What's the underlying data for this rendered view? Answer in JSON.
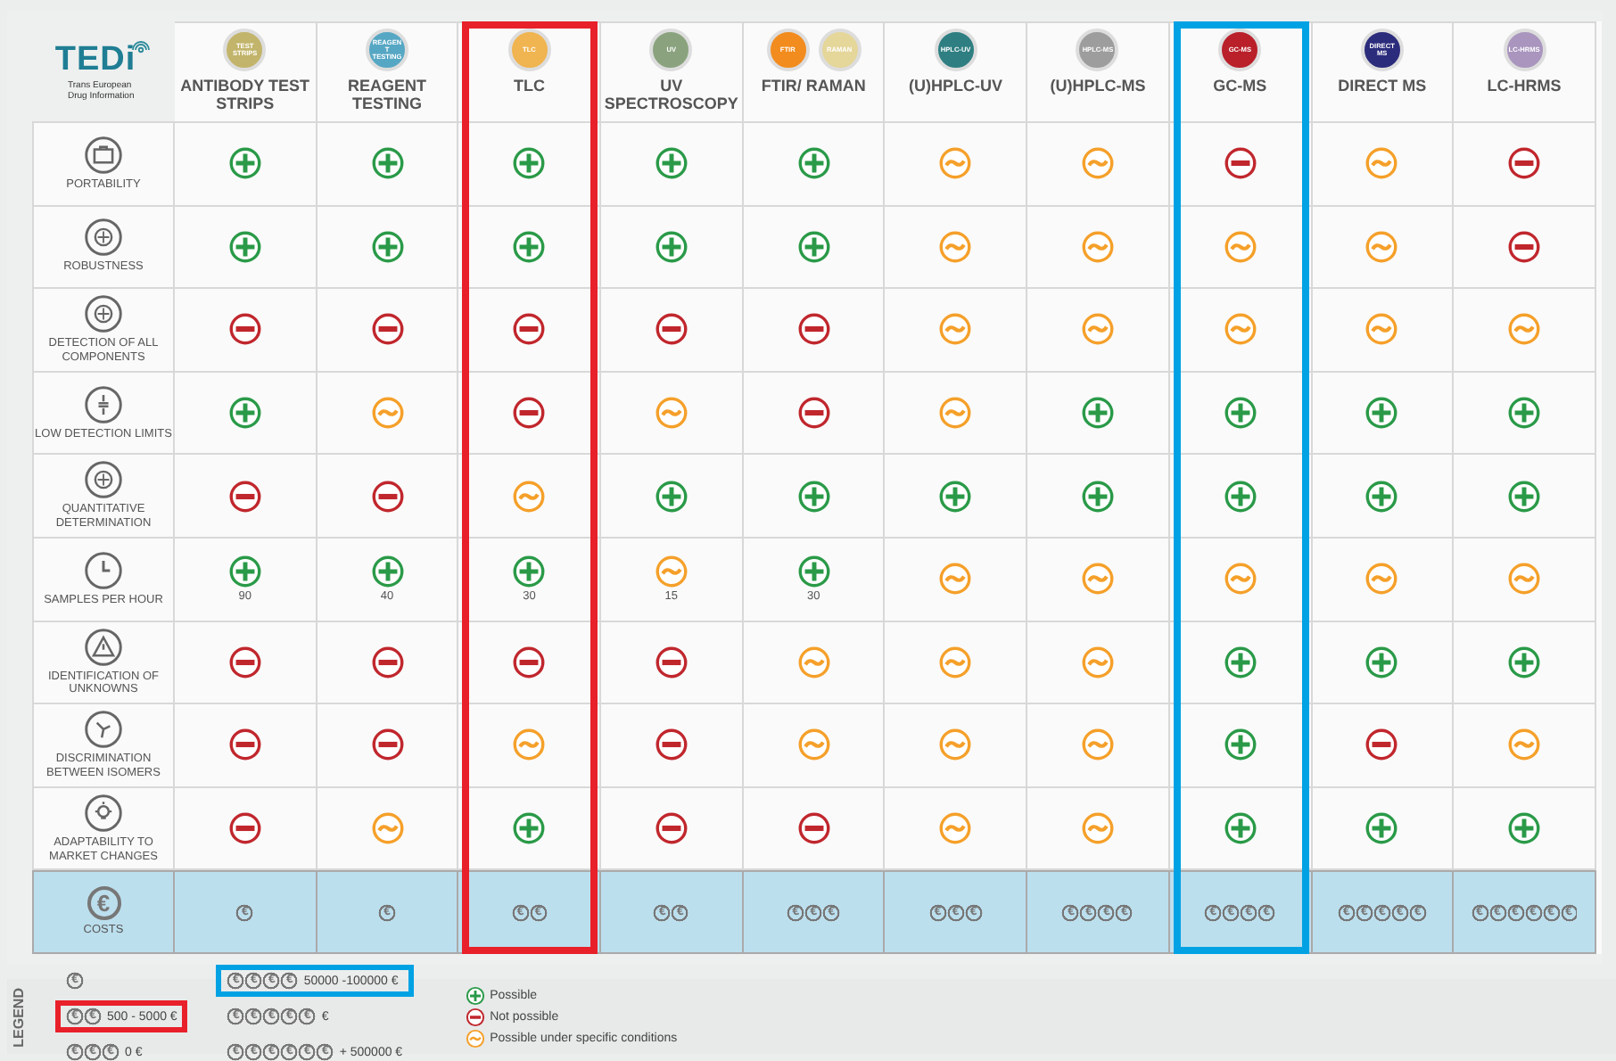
{
  "logo": {
    "name": "TEDi",
    "tagline": "Trans European Drug Information"
  },
  "columns": [
    {
      "badges": [
        {
          "text": "TEST STRIPS",
          "color": "#c2b46a"
        }
      ],
      "title": "ANTIBODY TEST STRIPS"
    },
    {
      "badges": [
        {
          "text": "REAGENT TESTING",
          "color": "#56a7c4"
        }
      ],
      "title": "REAGENT TESTING"
    },
    {
      "badges": [
        {
          "text": "TLC",
          "color": "#f0b450"
        }
      ],
      "title": "TLC",
      "framed": true,
      "color": "#e8202a"
    },
    {
      "badges": [
        {
          "text": "UV",
          "color": "#8aa37e"
        }
      ],
      "title": "UV SPECTROSCOPY"
    },
    {
      "badges": [
        {
          "text": "FTIR",
          "color": "#f28c1e"
        },
        {
          "text": "RAMAN",
          "color": "#e5d69a"
        }
      ],
      "title": "FTIR/ RAMAN"
    },
    {
      "badges": [
        {
          "text": "HPLC-UV",
          "color": "#2f7f82"
        }
      ],
      "title": "(U)HPLC-UV"
    },
    {
      "badges": [
        {
          "text": "HPLC-MS",
          "color": "#9d9d9d"
        }
      ],
      "title": "(U)HPLC-MS"
    },
    {
      "badges": [
        {
          "text": "GC-MS",
          "color": "#b9202a"
        }
      ],
      "title": "GC-MS",
      "framed": true,
      "color": "#00a2e4"
    },
    {
      "badges": [
        {
          "text": "DIRECT MS",
          "color": "#2c2c7c"
        }
      ],
      "title": "DIRECT MS"
    },
    {
      "badges": [
        {
          "text": "LC-HRMS",
          "color": "#a995be"
        }
      ],
      "title": "LC-HRMS"
    }
  ],
  "rows": [
    {
      "label": "PORTABILITY",
      "cells": [
        {
          "kind": "plus"
        },
        {
          "kind": "plus"
        },
        {
          "kind": "plus"
        },
        {
          "kind": "plus"
        },
        {
          "kind": "plus"
        },
        {
          "kind": "tilde"
        },
        {
          "kind": "tilde"
        },
        {
          "kind": "minus"
        },
        {
          "kind": "tilde"
        },
        {
          "kind": "minus"
        }
      ]
    },
    {
      "label": "ROBUSTNESS",
      "cells": [
        {
          "kind": "plus"
        },
        {
          "kind": "plus"
        },
        {
          "kind": "plus"
        },
        {
          "kind": "plus"
        },
        {
          "kind": "plus"
        },
        {
          "kind": "tilde"
        },
        {
          "kind": "tilde"
        },
        {
          "kind": "tilde"
        },
        {
          "kind": "tilde"
        },
        {
          "kind": "minus"
        }
      ]
    },
    {
      "label": "DETECTION OF ALL COMPONENTS",
      "cells": [
        {
          "kind": "minus"
        },
        {
          "kind": "minus"
        },
        {
          "kind": "minus"
        },
        {
          "kind": "minus"
        },
        {
          "kind": "minus"
        },
        {
          "kind": "tilde"
        },
        {
          "kind": "tilde"
        },
        {
          "kind": "tilde"
        },
        {
          "kind": "tilde"
        },
        {
          "kind": "tilde"
        }
      ]
    },
    {
      "label": "LOW DETECTION LIMITS",
      "cells": [
        {
          "kind": "plus"
        },
        {
          "kind": "tilde"
        },
        {
          "kind": "minus"
        },
        {
          "kind": "tilde"
        },
        {
          "kind": "minus"
        },
        {
          "kind": "tilde"
        },
        {
          "kind": "plus"
        },
        {
          "kind": "plus"
        },
        {
          "kind": "plus"
        },
        {
          "kind": "plus"
        }
      ]
    },
    {
      "label": "QUANTITATIVE DETERMINATION",
      "cells": [
        {
          "kind": "minus"
        },
        {
          "kind": "minus"
        },
        {
          "kind": "tilde"
        },
        {
          "kind": "plus"
        },
        {
          "kind": "plus"
        },
        {
          "kind": "plus"
        },
        {
          "kind": "plus"
        },
        {
          "kind": "plus"
        },
        {
          "kind": "plus"
        },
        {
          "kind": "plus"
        }
      ]
    },
    {
      "label": "SAMPLES PER HOUR",
      "cells": [
        {
          "kind": "plus",
          "note": "90"
        },
        {
          "kind": "plus",
          "note": "40"
        },
        {
          "kind": "plus",
          "note": "30"
        },
        {
          "kind": "tilde",
          "note": "15"
        },
        {
          "kind": "plus",
          "note": "30"
        },
        {
          "kind": "tilde"
        },
        {
          "kind": "tilde"
        },
        {
          "kind": "tilde"
        },
        {
          "kind": "tilde"
        },
        {
          "kind": "tilde"
        }
      ]
    },
    {
      "label": "IDENTIFICATION OF UNKNOWNS",
      "cells": [
        {
          "kind": "minus"
        },
        {
          "kind": "minus"
        },
        {
          "kind": "minus"
        },
        {
          "kind": "minus"
        },
        {
          "kind": "tilde"
        },
        {
          "kind": "tilde"
        },
        {
          "kind": "tilde"
        },
        {
          "kind": "plus"
        },
        {
          "kind": "plus"
        },
        {
          "kind": "plus"
        }
      ]
    },
    {
      "label": "DISCRIMINATION BETWEEN ISOMERS",
      "cells": [
        {
          "kind": "minus"
        },
        {
          "kind": "minus"
        },
        {
          "kind": "tilde"
        },
        {
          "kind": "minus"
        },
        {
          "kind": "tilde"
        },
        {
          "kind": "tilde"
        },
        {
          "kind": "tilde"
        },
        {
          "kind": "plus"
        },
        {
          "kind": "minus"
        },
        {
          "kind": "tilde"
        }
      ]
    },
    {
      "label": "ADAPTABILITY TO MARKET CHANGES",
      "cells": [
        {
          "kind": "minus"
        },
        {
          "kind": "tilde"
        },
        {
          "kind": "plus"
        },
        {
          "kind": "minus"
        },
        {
          "kind": "minus"
        },
        {
          "kind": "tilde"
        },
        {
          "kind": "tilde"
        },
        {
          "kind": "plus"
        },
        {
          "kind": "plus"
        },
        {
          "kind": "plus"
        }
      ]
    }
  ],
  "costs": {
    "label": "COSTS",
    "icon": "€",
    "cells": [
      "€",
      "€",
      "€€",
      "€€",
      "€€€",
      "€€€",
      "€€€€",
      "€€€€",
      "€€€€€",
      "€€€€€€"
    ]
  },
  "legend": {
    "title": "LEGEND",
    "cost_entries": [
      {
        "coins": "€"
      },
      {
        "coins": "€€",
        "text": "500 - 5000 €",
        "framed": true,
        "color": "#e8202a"
      },
      {
        "coins": "€€€",
        "text": "0 €"
      },
      {
        "coins": "€€€€",
        "text": "50000 -100000 €",
        "framed": true,
        "color": "#00a2e4"
      },
      {
        "coins": "€€€€€",
        "text": "€"
      },
      {
        "coins": "€€€€€€",
        "text": "+ 500000 €"
      }
    ],
    "symbols": [
      {
        "kind": "plus",
        "text": "Possible"
      },
      {
        "kind": "minus",
        "text": "Not possible"
      },
      {
        "kind": "tilde",
        "text": "Possible under specific conditions"
      }
    ]
  }
}
